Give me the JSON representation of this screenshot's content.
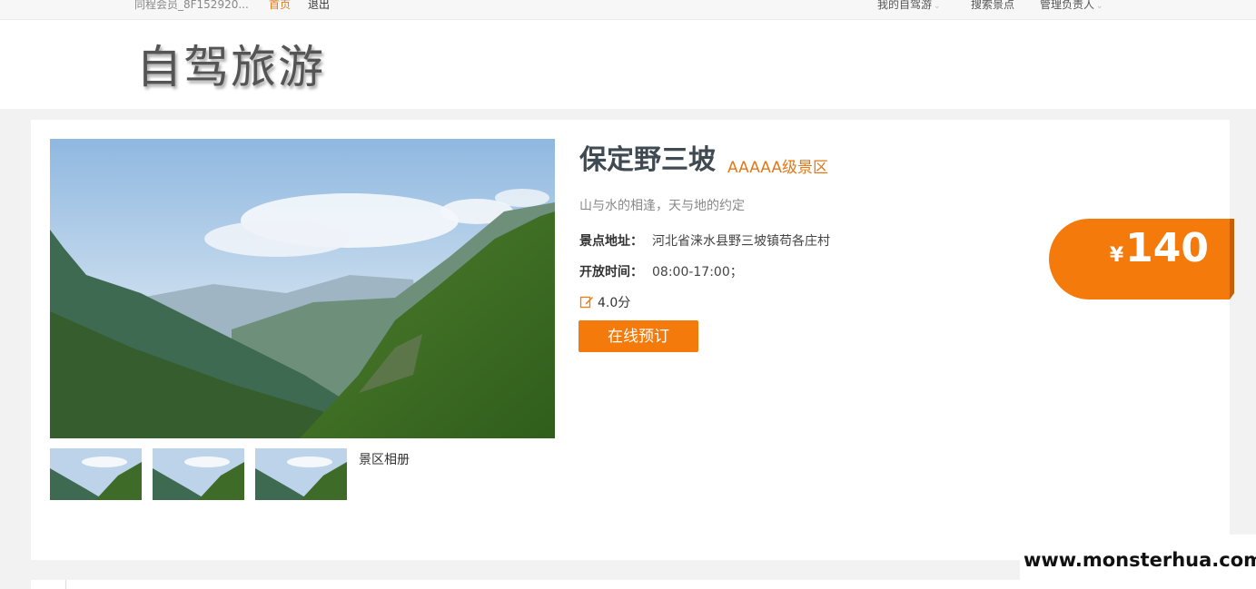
{
  "topbar": {
    "user": "同程会员_8F152920...",
    "home": "首页",
    "logout": "退出",
    "my_trips": "我的自驾游",
    "search": "搜索景点",
    "manager": "管理负责人"
  },
  "header": {
    "logo": "自驾旅游"
  },
  "attraction": {
    "name": "保定野三坡",
    "level": "AAAAA级景区",
    "slogan": "山与水的相逢，天与地的约定",
    "address_label": "景点地址：",
    "address": "河北省涞水县野三坡镇苟各庄村",
    "hours_label": "开放时间：",
    "hours": "08:00-17:00；",
    "rating": "4.0分",
    "book_label": "在线预订",
    "album_label": "景区相册",
    "currency": "¥",
    "price": "140"
  },
  "colors": {
    "accent": "#f47a0b",
    "title": "#404a52"
  },
  "watermark": "www.monsterhua.com"
}
